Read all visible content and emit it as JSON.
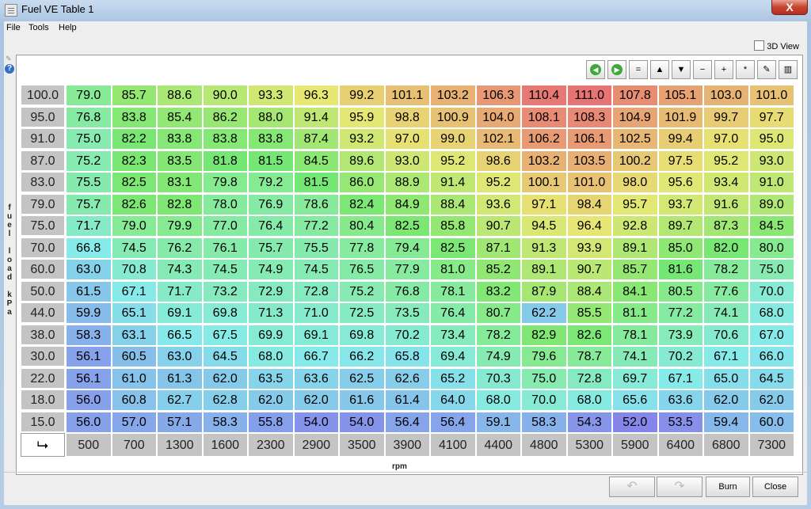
{
  "window": {
    "title": "Fuel VE Table 1",
    "close_label": "X"
  },
  "menu": {
    "items": [
      "File",
      "Tools",
      "Help"
    ]
  },
  "view3d_label": "3D View",
  "toolbar": {
    "buttons": [
      "◀",
      "▶",
      "=",
      "▲",
      "▼",
      "−",
      "+",
      "*",
      "✎",
      "▥"
    ]
  },
  "table": {
    "y_axis_label": "fuel load kPa",
    "x_axis_label": "rpm",
    "rpm": [
      "500",
      "700",
      "1300",
      "1600",
      "2300",
      "2900",
      "3500",
      "3900",
      "4100",
      "4400",
      "4800",
      "5300",
      "5900",
      "6400",
      "6800",
      "7300"
    ],
    "load": [
      "100.0",
      "95.0",
      "91.0",
      "87.0",
      "83.0",
      "79.0",
      "75.0",
      "70.0",
      "60.0",
      "50.0",
      "44.0",
      "38.0",
      "30.0",
      "22.0",
      "18.0",
      "15.0"
    ],
    "rows": [
      [
        "79.0",
        "85.7",
        "88.6",
        "90.0",
        "93.3",
        "96.3",
        "99.2",
        "101.1",
        "103.2",
        "106.3",
        "110.4",
        "111.0",
        "107.8",
        "105.1",
        "103.0",
        "101.0"
      ],
      [
        "76.8",
        "83.8",
        "85.4",
        "86.2",
        "88.0",
        "91.4",
        "95.9",
        "98.8",
        "100.9",
        "104.0",
        "108.1",
        "108.3",
        "104.9",
        "101.9",
        "99.7",
        "97.7"
      ],
      [
        "75.0",
        "82.2",
        "83.8",
        "83.8",
        "83.8",
        "87.4",
        "93.2",
        "97.0",
        "99.0",
        "102.1",
        "106.2",
        "106.1",
        "102.5",
        "99.4",
        "97.0",
        "95.0"
      ],
      [
        "75.2",
        "82.3",
        "83.5",
        "81.8",
        "81.5",
        "84.5",
        "89.6",
        "93.0",
        "95.2",
        "98.6",
        "103.2",
        "103.5",
        "100.2",
        "97.5",
        "95.2",
        "93.0"
      ],
      [
        "75.5",
        "82.5",
        "83.1",
        "79.8",
        "79.2",
        "81.5",
        "86.0",
        "88.9",
        "91.4",
        "95.2",
        "100.1",
        "101.0",
        "98.0",
        "95.6",
        "93.4",
        "91.0"
      ],
      [
        "75.7",
        "82.6",
        "82.8",
        "78.0",
        "76.9",
        "78.6",
        "82.4",
        "84.9",
        "88.4",
        "93.6",
        "97.1",
        "98.4",
        "95.7",
        "93.7",
        "91.6",
        "89.0"
      ],
      [
        "71.7",
        "79.0",
        "79.9",
        "77.0",
        "76.4",
        "77.2",
        "80.4",
        "82.5",
        "85.8",
        "90.7",
        "94.5",
        "96.4",
        "92.8",
        "89.7",
        "87.3",
        "84.5"
      ],
      [
        "66.8",
        "74.5",
        "76.2",
        "76.1",
        "75.7",
        "75.5",
        "77.8",
        "79.4",
        "82.5",
        "87.1",
        "91.3",
        "93.9",
        "89.1",
        "85.0",
        "82.0",
        "80.0"
      ],
      [
        "63.0",
        "70.8",
        "74.3",
        "74.5",
        "74.9",
        "74.5",
        "76.5",
        "77.9",
        "81.0",
        "85.2",
        "89.1",
        "90.7",
        "85.7",
        "81.6",
        "78.2",
        "75.0"
      ],
      [
        "61.5",
        "67.1",
        "71.7",
        "73.2",
        "72.9",
        "72.8",
        "75.2",
        "76.8",
        "78.1",
        "83.2",
        "87.9",
        "88.4",
        "84.1",
        "80.5",
        "77.6",
        "70.0"
      ],
      [
        "59.9",
        "65.1",
        "69.1",
        "69.8",
        "71.3",
        "71.0",
        "72.5",
        "73.5",
        "76.4",
        "80.7",
        "62.2",
        "85.5",
        "81.1",
        "77.2",
        "74.1",
        "68.0"
      ],
      [
        "58.3",
        "63.1",
        "66.5",
        "67.5",
        "69.9",
        "69.1",
        "69.8",
        "70.2",
        "73.4",
        "78.2",
        "82.9",
        "82.6",
        "78.1",
        "73.9",
        "70.6",
        "67.0"
      ],
      [
        "56.1",
        "60.5",
        "63.0",
        "64.5",
        "68.0",
        "66.7",
        "66.2",
        "65.8",
        "69.4",
        "74.9",
        "79.6",
        "78.7",
        "74.1",
        "70.2",
        "67.1",
        "66.0"
      ],
      [
        "56.1",
        "61.0",
        "61.3",
        "62.0",
        "63.5",
        "63.6",
        "62.5",
        "62.6",
        "65.2",
        "70.3",
        "75.0",
        "72.8",
        "69.7",
        "67.1",
        "65.0",
        "64.5"
      ],
      [
        "56.0",
        "60.8",
        "62.7",
        "62.8",
        "62.0",
        "62.0",
        "61.6",
        "61.4",
        "64.0",
        "68.0",
        "70.0",
        "68.0",
        "65.6",
        "63.6",
        "62.0",
        "62.0"
      ],
      [
        "56.0",
        "57.0",
        "57.1",
        "58.3",
        "55.8",
        "54.0",
        "54.0",
        "56.4",
        "56.4",
        "59.1",
        "58.3",
        "54.3",
        "52.0",
        "53.5",
        "59.4",
        "60.0"
      ]
    ]
  },
  "buttons": {
    "undo": "↶",
    "redo": "↷",
    "burn": "Burn",
    "close": "Close"
  }
}
